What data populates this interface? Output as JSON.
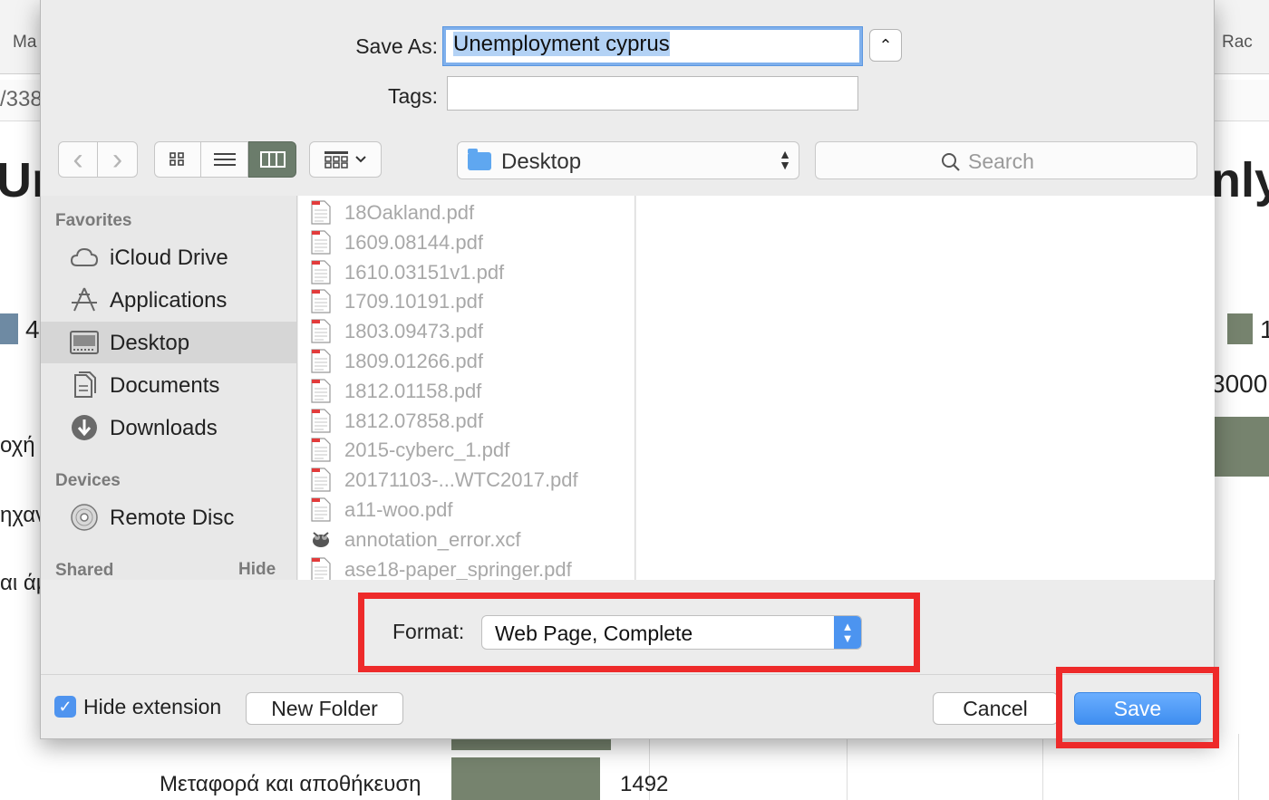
{
  "background_page": {
    "tab_left": "Ma",
    "tab_right": "Rac",
    "url_fragment": "/338",
    "heading_left": "Un",
    "heading_right": "nly",
    "legend_left_value": "4",
    "legend_right_value": "1",
    "axis_value_right": "3000",
    "categories_left": [
      "οχή",
      "ηχαν",
      "αι άμ"
    ],
    "bottom_category": "Μεταφορά και αποθήκευση",
    "bottom_value": "1492",
    "colors": {
      "bar": "#76836e",
      "legend_left": "#6e8aa3"
    }
  },
  "dialog": {
    "save_as_label": "Save As:",
    "save_as_value": "Unemployment cyprus",
    "disclosure_symbol": "⌃",
    "tags_label": "Tags:",
    "tags_value": "",
    "toolbar": {
      "back_glyph": "‹",
      "forward_glyph": "›",
      "location": "Desktop",
      "search_placeholder": "Search"
    },
    "sidebar": {
      "favorites_header": "Favorites",
      "favorites": [
        {
          "label": "iCloud Drive",
          "icon": "cloud-icon"
        },
        {
          "label": "Applications",
          "icon": "applications-icon"
        },
        {
          "label": "Desktop",
          "icon": "desktop-icon",
          "selected": true
        },
        {
          "label": "Documents",
          "icon": "documents-icon"
        },
        {
          "label": "Downloads",
          "icon": "downloads-icon"
        }
      ],
      "devices_header": "Devices",
      "devices": [
        {
          "label": "Remote Disc",
          "icon": "disc-icon"
        }
      ],
      "shared_header": "Shared",
      "shared_hide": "Hide"
    },
    "files": [
      {
        "name": "18Oakland.pdf",
        "type": "pdf"
      },
      {
        "name": "1609.08144.pdf",
        "type": "pdf"
      },
      {
        "name": "1610.03151v1.pdf",
        "type": "pdf"
      },
      {
        "name": "1709.10191.pdf",
        "type": "pdf"
      },
      {
        "name": "1803.09473.pdf",
        "type": "pdf"
      },
      {
        "name": "1809.01266.pdf",
        "type": "pdf"
      },
      {
        "name": "1812.01158.pdf",
        "type": "pdf"
      },
      {
        "name": "1812.07858.pdf",
        "type": "pdf"
      },
      {
        "name": "2015-cyberc_1.pdf",
        "type": "pdf"
      },
      {
        "name": "20171103-...WTC2017.pdf",
        "type": "pdf"
      },
      {
        "name": "a11-woo.pdf",
        "type": "pdf"
      },
      {
        "name": "annotation_error.xcf",
        "type": "xcf"
      },
      {
        "name": "ase18-paper_springer.pdf",
        "type": "pdf"
      }
    ],
    "format_label": "Format:",
    "format_value": "Web Page, Complete",
    "hide_extension_label": "Hide extension",
    "hide_extension_checked": true,
    "new_folder_label": "New Folder",
    "cancel_label": "Cancel",
    "save_label": "Save",
    "colors": {
      "accent": "#4f94ef",
      "highlight_box": "#ee2a2a"
    }
  }
}
